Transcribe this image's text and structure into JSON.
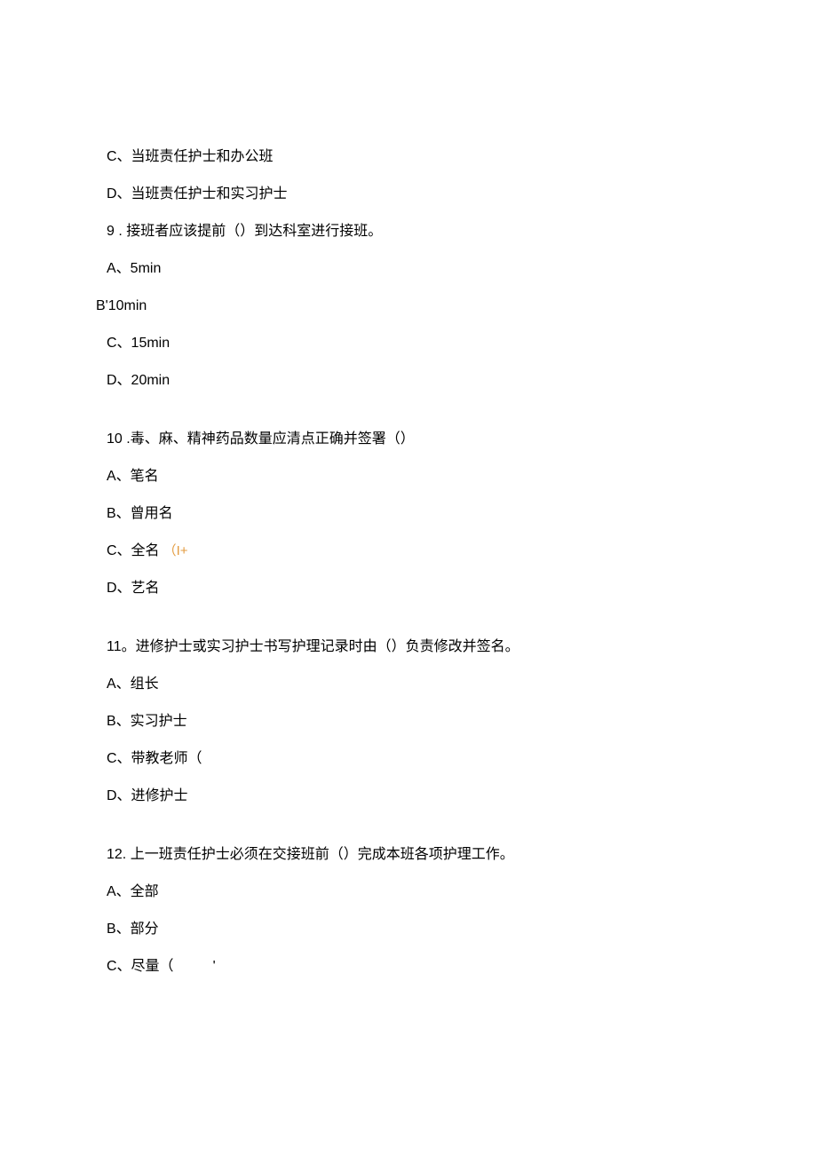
{
  "lines": [
    {
      "text": "C、当班责任护士和办公班",
      "class": "line"
    },
    {
      "text": "D、当班责任护士和实习护士",
      "class": "line"
    },
    {
      "text": "9   . 接班者应该提前（）到达科室进行接班。",
      "class": "line"
    },
    {
      "text": "A、5min",
      "class": "line"
    },
    {
      "text": "B'10min",
      "class": "line outdent"
    },
    {
      "text": "C、15min",
      "class": "line"
    },
    {
      "text": "D、20min",
      "class": "line"
    },
    {
      "text": "",
      "class": "spacer"
    },
    {
      "text": "10   .毒、麻、精神药品数量应清点正确并签署（）",
      "class": "line"
    },
    {
      "text": "A、笔名",
      "class": "line"
    },
    {
      "text": "B、曾用名",
      "class": "line"
    },
    {
      "text": "C、全名",
      "class": "line",
      "annotation": "（I+"
    },
    {
      "text": "D、艺名",
      "class": "line"
    },
    {
      "text": "",
      "class": "spacer"
    },
    {
      "text": "11。进修护士或实习护士书写护理记录时由（）负责修改并签名。",
      "class": "line"
    },
    {
      "text": "A、组长",
      "class": "line"
    },
    {
      "text": "B、实习护士",
      "class": "line"
    },
    {
      "text": "C、带教老师（",
      "class": "line"
    },
    {
      "text": "D、进修护士",
      "class": "line"
    },
    {
      "text": "",
      "class": "spacer"
    },
    {
      "text": "12. 上一班责任护士必须在交接班前（）完成本班各项护理工作。",
      "class": "line"
    },
    {
      "text": "A、全部",
      "class": "line"
    },
    {
      "text": "B、部分",
      "class": "line"
    },
    {
      "text": "C、尽量（",
      "class": "line",
      "trail": "'"
    }
  ]
}
